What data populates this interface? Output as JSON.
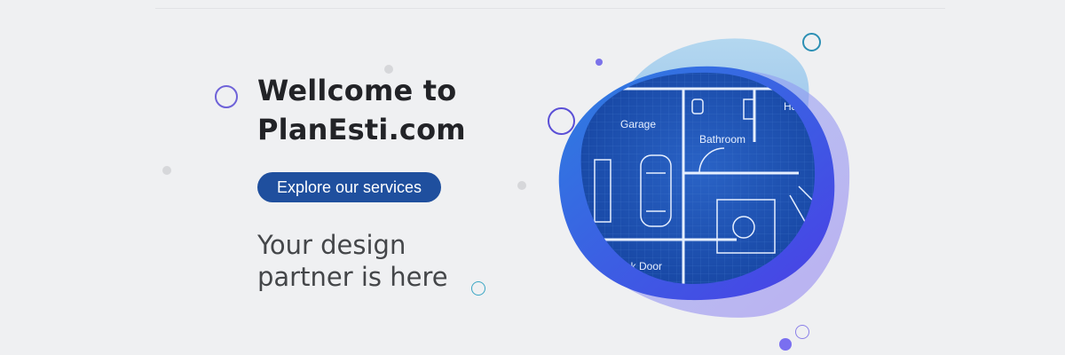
{
  "hero": {
    "title_line1": "Wellcome to",
    "title_line2": "PlanEsti.com",
    "cta_label": "Explore our services",
    "tagline_line1": "Your design",
    "tagline_line2": "partner is here"
  },
  "blueprint": {
    "room_labels": [
      "Garage",
      "Bathroom",
      "Back Door",
      "Ha"
    ]
  },
  "icons": {
    "decorations": "decorative-circles"
  },
  "colors": {
    "background": "#eff0f2",
    "button": "#1f4f9e",
    "heading": "#222327",
    "blob_light": "#90c5ec",
    "blob_blue": "#3b6ff0",
    "blueprint": "#1a4fb0"
  }
}
